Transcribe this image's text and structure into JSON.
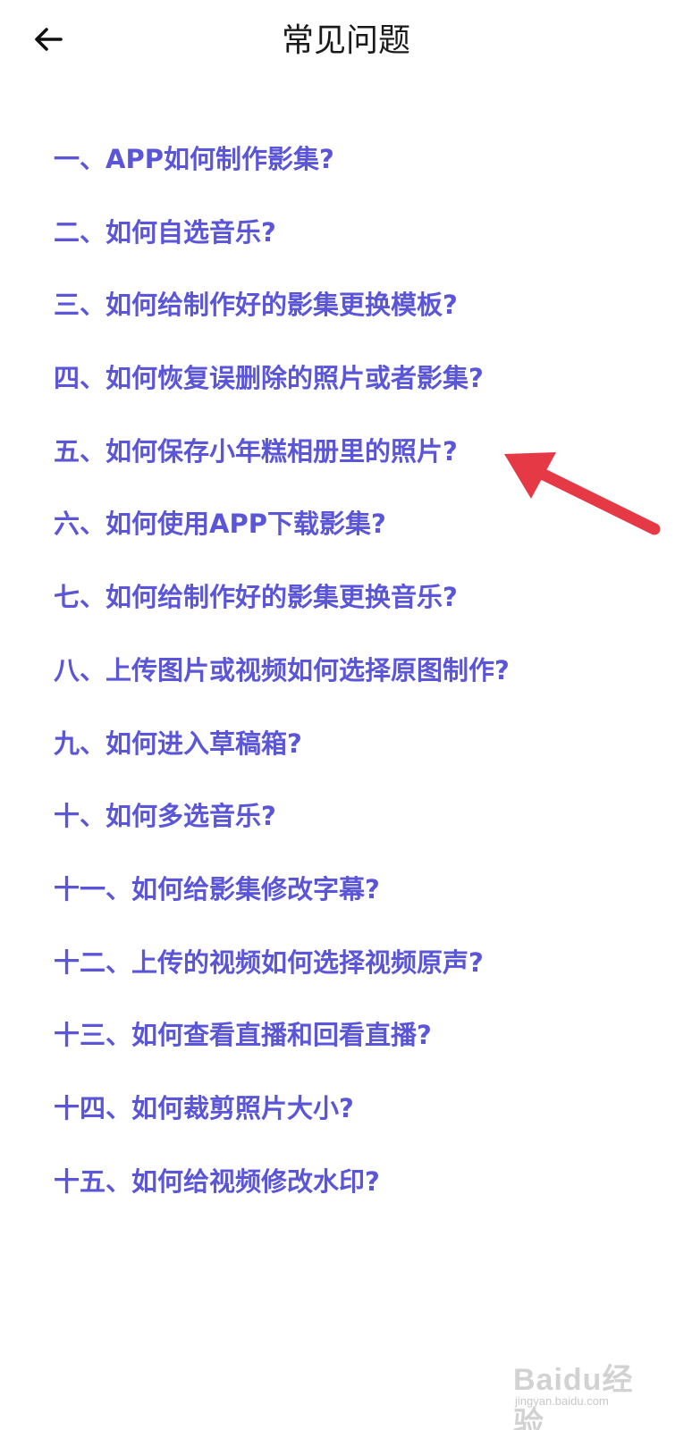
{
  "header": {
    "title": "常见问题",
    "back_icon": "arrow-left-icon"
  },
  "faq": {
    "items": [
      "一、APP如何制作影集?",
      "二、如何自选音乐?",
      "三、如何给制作好的影集更换模板?",
      "四、如何恢复误删除的照片或者影集?",
      "五、如何保存小年糕相册里的照片?",
      "六、如何使用APP下载影集?",
      "七、如何给制作好的影集更换音乐?",
      "八、上传图片或视频如何选择原图制作?",
      "九、如何进入草稿箱?",
      "十、如何多选音乐?",
      "十一、如何给影集修改字幕?",
      "十二、上传的视频如何选择视频原声?",
      "十三、如何查看直播和回看直播?",
      "十四、如何裁剪照片大小?",
      "十五、如何给视频修改水印?"
    ]
  },
  "annotation": {
    "icon": "red-pointer-arrow-icon",
    "color": "#e63946"
  },
  "watermark": {
    "logo": "Baidu经验",
    "sub": "jingyan.baidu.com"
  },
  "colors": {
    "link": "#5b55d8",
    "title": "#1a1a1a",
    "background": "#ffffff"
  }
}
